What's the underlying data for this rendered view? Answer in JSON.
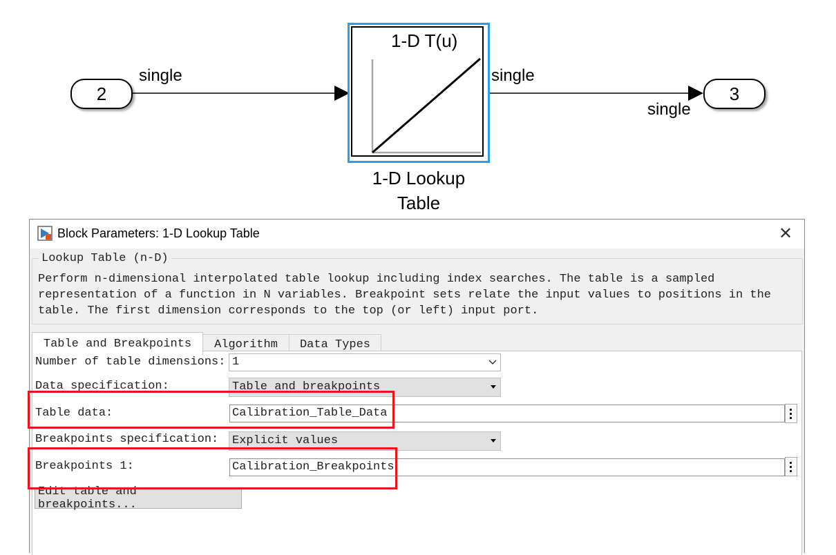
{
  "model": {
    "input_port": {
      "number": "2",
      "signal_label": "single"
    },
    "block": {
      "icon_title": "1-D T(u)",
      "name_line1": "1-D Lookup",
      "name_line2": "Table"
    },
    "output_signal_label": "single",
    "output_port": {
      "number": "3",
      "data_type_label": "single"
    },
    "colors": {
      "selection": "#2f9bea"
    }
  },
  "dialog": {
    "title": "Block Parameters: 1-D Lookup Table",
    "group_title": "Lookup Table (n-D)",
    "description": "Perform n-dimensional interpolated table lookup including index searches. The table is a sampled\nrepresentation of a function in N variables. Breakpoint sets relate the input values to positions in the\ntable. The first dimension corresponds to the top (or left) input port.",
    "tabs": [
      "Table and Breakpoints",
      "Algorithm",
      "Data Types"
    ],
    "active_tab": "Table and Breakpoints",
    "params": {
      "num_dims_label": "Number of table dimensions:",
      "num_dims_value": "1",
      "data_spec_label": "Data specification:",
      "data_spec_value": "Table and breakpoints",
      "table_data_label": "Table data:",
      "table_data_value": "Calibration_Table_Data",
      "bp_spec_label": "Breakpoints specification:",
      "bp_spec_value": "Explicit values",
      "bp1_label": "Breakpoints 1:",
      "bp1_value": "Calibration_Breakpoints",
      "edit_button": "Edit table and breakpoints..."
    },
    "colors": {
      "highlight": "#e8161b"
    }
  }
}
